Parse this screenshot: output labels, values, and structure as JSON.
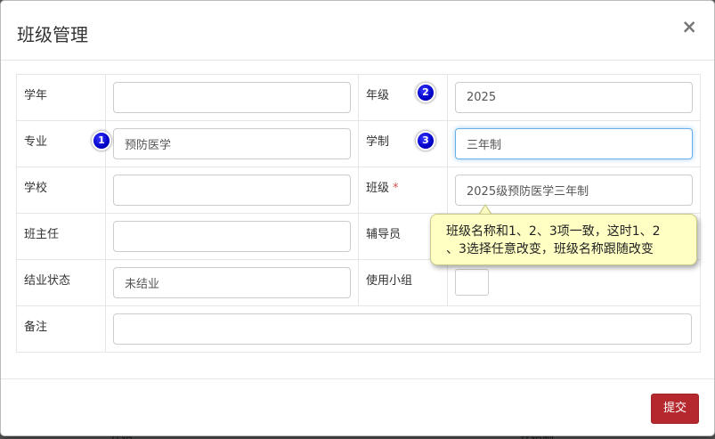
{
  "backdrop": {
    "left_text": "开始",
    "right_text": "开始制"
  },
  "modal": {
    "title": "班级管理",
    "close_glyph": "×"
  },
  "form": {
    "rows": [
      {
        "left_label": "学年",
        "left_value": "",
        "right_label": "年级",
        "right_value": "2025"
      },
      {
        "left_label": "专业",
        "left_value": "预防医学",
        "right_label": "学制",
        "right_value": "三年制"
      },
      {
        "left_label": "学校",
        "left_value": "",
        "right_label": "班级",
        "right_value": "2025级预防医学三年制",
        "right_required": "*"
      },
      {
        "left_label": "班主任",
        "left_value": "",
        "right_label": "辅导员",
        "right_value": ""
      },
      {
        "left_label": "结业状态",
        "left_value": "未结业",
        "right_label": "使用小组",
        "right_value": ""
      }
    ],
    "remark_label": "备注",
    "remark_value": ""
  },
  "badges": {
    "one": "1",
    "two": "2",
    "three": "3"
  },
  "callout": {
    "line1": "班级名称和1、2、3项一致，这时1、2",
    "line2": "、3选择任意改变，班级名称跟随改变"
  },
  "footer": {
    "submit_label": "提交"
  },
  "colors": {
    "submit_bg": "#b5282d",
    "badge": "#0000c8",
    "callout_bg": "#ffffc4",
    "focus_border": "#66afe9",
    "required": "#d9534f"
  }
}
